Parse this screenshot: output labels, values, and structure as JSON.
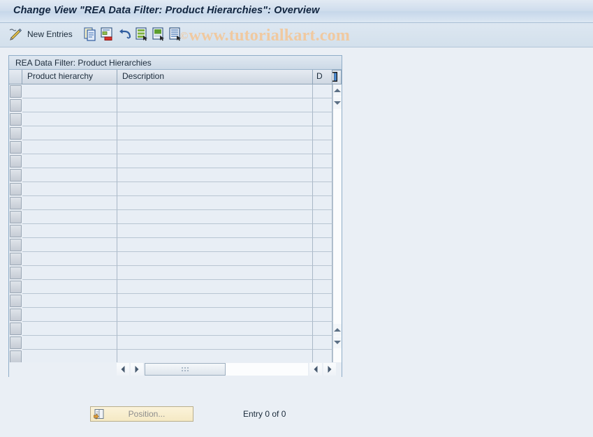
{
  "window": {
    "title": "Change View \"REA Data Filter: Product Hierarchies\": Overview"
  },
  "toolbar": {
    "pencil_icon": "pencil-display-change-icon",
    "new_entries_label": "New Entries",
    "copy_icon": "copy-as-icon",
    "delete_icon": "delete-entry-icon",
    "undo_icon": "undo-change-icon",
    "select_all_icon": "select-all-icon",
    "deselect_all_icon": "deselect-all-icon",
    "select_block_icon": "select-block-icon"
  },
  "watermark": {
    "copyright_glyph": "©",
    "text": "www.tutorialkart.com"
  },
  "panel": {
    "caption": "REA Data Filter: Product Hierarchies",
    "config_icon": "column-configuration-icon"
  },
  "grid": {
    "columns": [
      {
        "key": "select",
        "label": ""
      },
      {
        "key": "product_hierarchy",
        "label": "Product hierarchy"
      },
      {
        "key": "description",
        "label": "Description"
      },
      {
        "key": "d",
        "label": "D"
      }
    ],
    "rows": [
      {
        "product_hierarchy": "",
        "description": "",
        "d": ""
      },
      {
        "product_hierarchy": "",
        "description": "",
        "d": ""
      },
      {
        "product_hierarchy": "",
        "description": "",
        "d": ""
      },
      {
        "product_hierarchy": "",
        "description": "",
        "d": ""
      },
      {
        "product_hierarchy": "",
        "description": "",
        "d": ""
      },
      {
        "product_hierarchy": "",
        "description": "",
        "d": ""
      },
      {
        "product_hierarchy": "",
        "description": "",
        "d": ""
      },
      {
        "product_hierarchy": "",
        "description": "",
        "d": ""
      },
      {
        "product_hierarchy": "",
        "description": "",
        "d": ""
      },
      {
        "product_hierarchy": "",
        "description": "",
        "d": ""
      },
      {
        "product_hierarchy": "",
        "description": "",
        "d": ""
      },
      {
        "product_hierarchy": "",
        "description": "",
        "d": ""
      },
      {
        "product_hierarchy": "",
        "description": "",
        "d": ""
      },
      {
        "product_hierarchy": "",
        "description": "",
        "d": ""
      },
      {
        "product_hierarchy": "",
        "description": "",
        "d": ""
      },
      {
        "product_hierarchy": "",
        "description": "",
        "d": ""
      },
      {
        "product_hierarchy": "",
        "description": "",
        "d": ""
      },
      {
        "product_hierarchy": "",
        "description": "",
        "d": ""
      },
      {
        "product_hierarchy": "",
        "description": "",
        "d": ""
      },
      {
        "product_hierarchy": "",
        "description": "",
        "d": ""
      }
    ]
  },
  "scrollbars": {
    "vertical": {
      "up_icon": "scroll-up-icon",
      "down_icon": "scroll-down-icon",
      "page_up_icon": "scroll-page-up-icon",
      "page_down_icon": "scroll-page-down-icon"
    },
    "horizontal": {
      "left_icon": "scroll-left-icon",
      "right_icon": "scroll-right-icon",
      "thumb_grip_icon": "scroll-thumb-grip-icon"
    }
  },
  "footer": {
    "position_button_label": "Position...",
    "position_button_icon": "position-goto-icon",
    "entry_count": "Entry 0 of 0"
  },
  "colors": {
    "title_text": "#11253f",
    "panel_border": "#8fadc8",
    "grid_cell_bg": "#e8eef5",
    "page_bg": "#eaeff5",
    "watermark": "#f0c9a0",
    "position_button_bg": "#f5e9c4"
  }
}
